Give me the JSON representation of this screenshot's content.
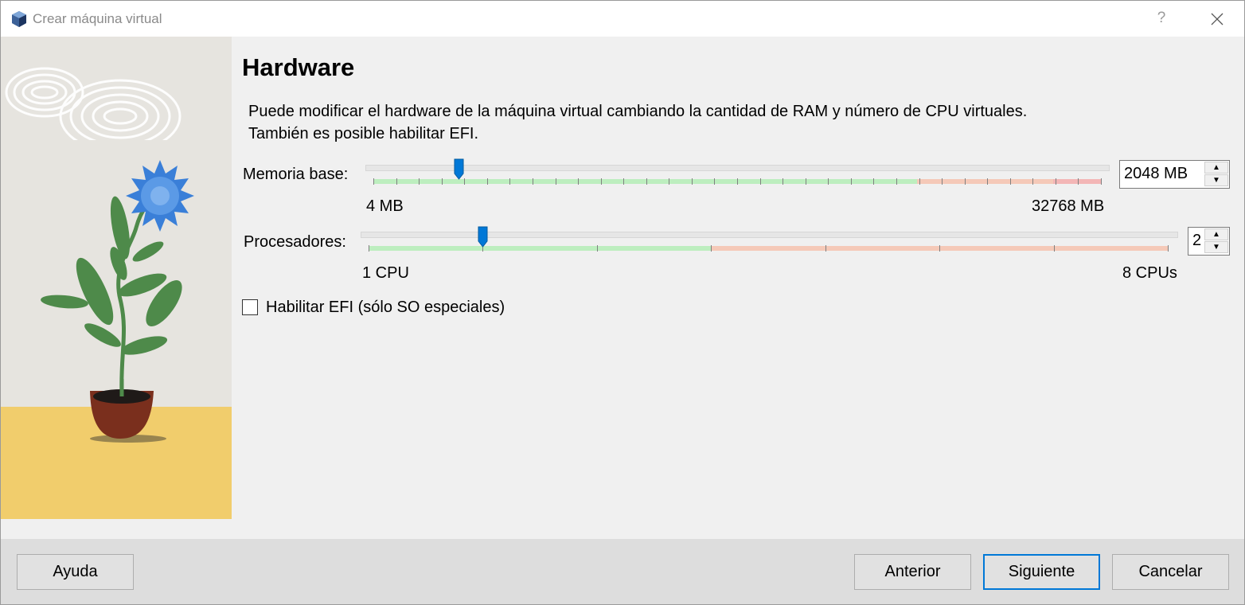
{
  "window": {
    "title": "Crear máquina virtual",
    "help_label": "?"
  },
  "page": {
    "heading": "Hardware",
    "description_line1": "Puede modificar el hardware de la máquina virtual cambiando la cantidad de RAM y número de CPU virtuales.",
    "description_line2": "También es posible habilitar EFI."
  },
  "memory": {
    "label": "Memoria base:",
    "value": 2048,
    "display": "2048 MB",
    "min_label": "4 MB",
    "max_label": "32768 MB",
    "min": 4,
    "max": 32768
  },
  "cpu": {
    "label": "Procesadores:",
    "value": 2,
    "display": "2",
    "min_label": "1 CPU",
    "max_label": "8 CPUs",
    "min": 1,
    "max": 8
  },
  "efi": {
    "label": "Habilitar EFI (sólo SO especiales)",
    "checked": false
  },
  "buttons": {
    "help": "Ayuda",
    "back": "Anterior",
    "next": "Siguiente",
    "cancel": "Cancelar"
  },
  "colors": {
    "accent": "#0078d7",
    "safe": "#bdeebf",
    "warning": "#f5c9b8",
    "danger": "#f3b6b6",
    "floor": "#f1cd6c",
    "flower": "#3a7fd8",
    "leaves": "#4e8a4a",
    "pot": "#7a2f1d"
  }
}
